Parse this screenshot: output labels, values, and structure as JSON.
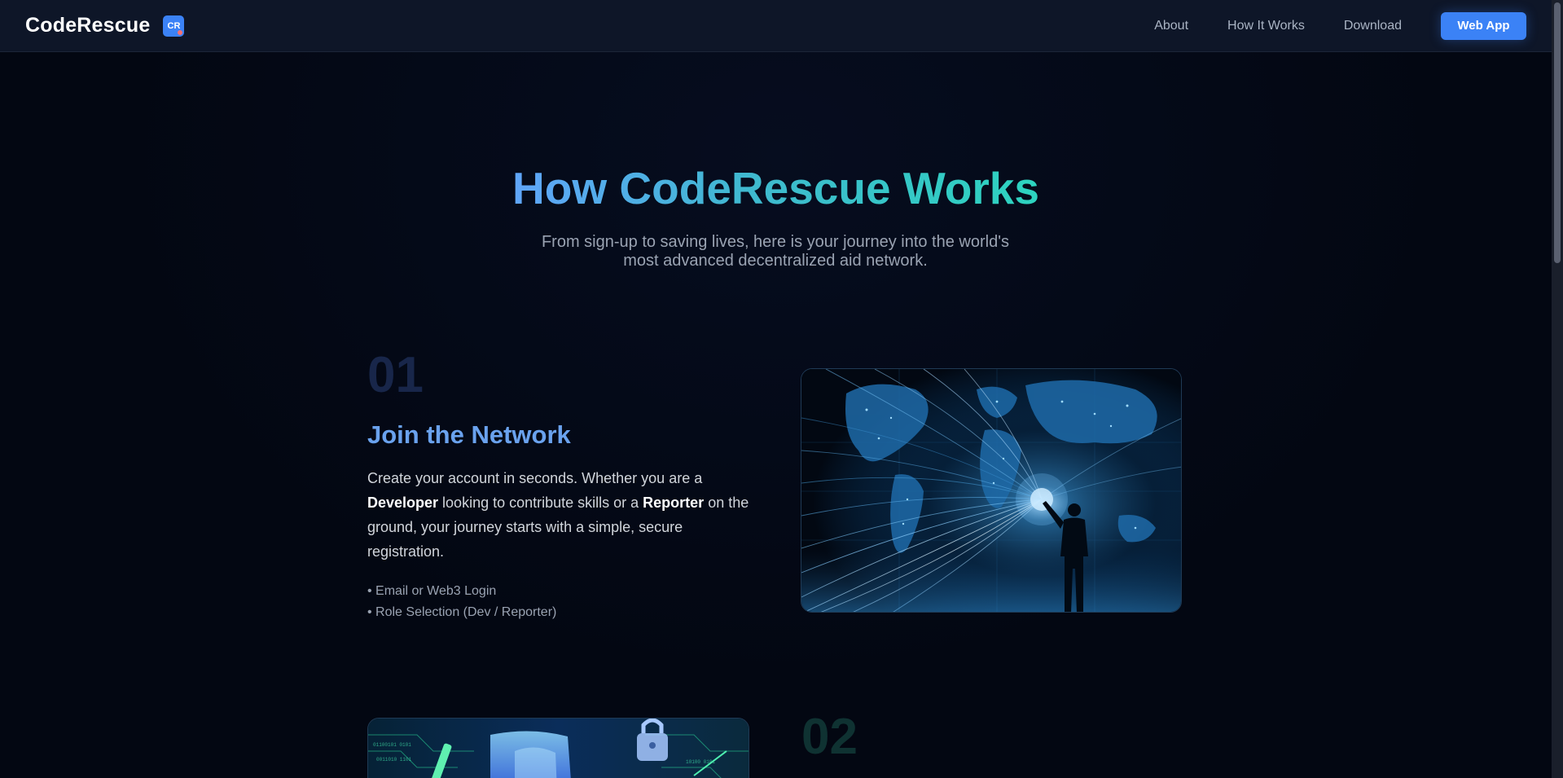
{
  "navbar": {
    "brand_name": "CodeRescue",
    "logo_text": "CR",
    "links": [
      "About",
      "How It Works",
      "Download"
    ],
    "cta_label": "Web App"
  },
  "hero": {
    "title": "How CodeRescue Works",
    "subtitle": "From sign-up to saving lives, here is your journey into the world's most advanced decentralized aid network."
  },
  "steps": [
    {
      "number": "01",
      "title": "Join the Network",
      "desc_part1": "Create your account in seconds. Whether you are a ",
      "desc_bold1": "Developer",
      "desc_part2": " looking to contribute skills or a ",
      "desc_bold2": "Reporter",
      "desc_part3": " on the ground, your journey starts with a simple, secure registration.",
      "bullets": [
        "• Email or Web3 Login",
        "• Role Selection (Dev / Reporter)"
      ]
    },
    {
      "number": "02"
    }
  ],
  "colors": {
    "accent": "#3b82f6",
    "title_gradient_start": "#60a5fa",
    "title_gradient_end": "#2dd4bf",
    "step_title": "#6aa2ee",
    "background": "#030712",
    "navbar": "#0e1628"
  }
}
